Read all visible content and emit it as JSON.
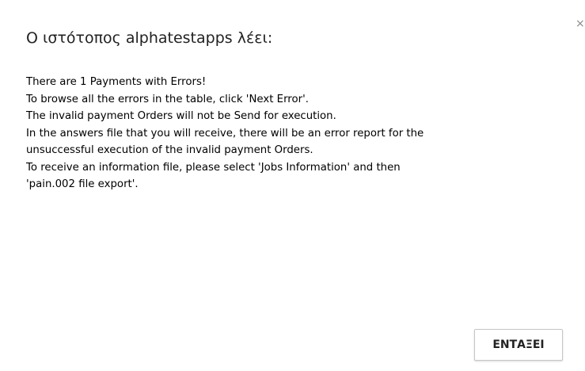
{
  "dialog": {
    "title": "Ο ιστότοπος alphatestapps λέει:",
    "close_label": "×",
    "message_lines": [
      "There are 1 Payments with Errors!",
      "To browse all the errors in the table, click 'Next Error'.",
      "The invalid payment Orders will not be Send for execution.",
      "In the answers file that you will receive, there will be an error report for the",
      "unsuccessful execution of the invalid payment Orders.",
      "To receive an information file, please select 'Jobs Information' and then",
      "'pain.002 file export'."
    ],
    "ok_label": "ΕΝΤΑΞΕΙ"
  }
}
